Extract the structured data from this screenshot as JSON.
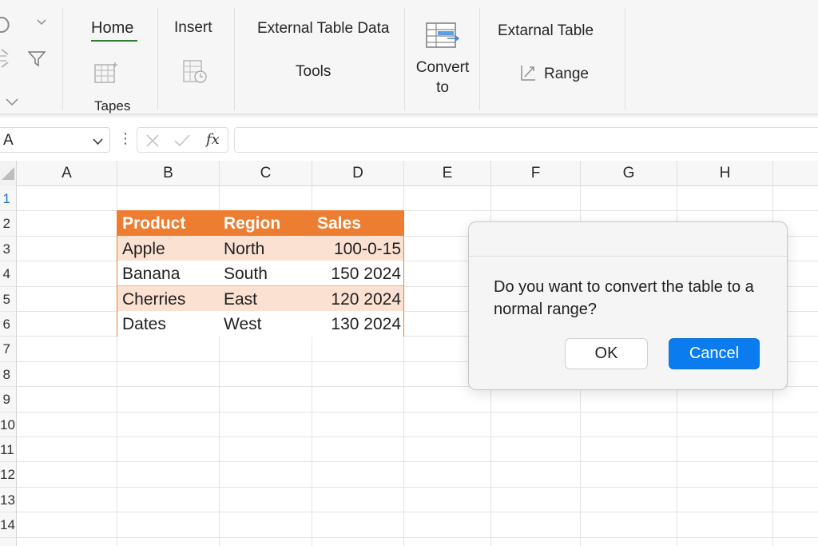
{
  "ribbon": {
    "tabs": {
      "home": "Home",
      "insert": "Insert",
      "external_table_data": "External Table Data",
      "tools": "Tools",
      "convert_to": [
        "Convert",
        "to"
      ],
      "external_table": "Extarnal Table",
      "range": "Range",
      "tapes": "Tapes"
    },
    "active_tab": "Home"
  },
  "formula_bar": {
    "name_box": "A",
    "fx_label": "fx",
    "formula": ""
  },
  "grid": {
    "columns": [
      "A",
      "B",
      "C",
      "D",
      "E",
      "F",
      "G",
      "H"
    ],
    "rows": [
      "1",
      "2",
      "3",
      "4",
      "5",
      "6",
      "7",
      "8",
      "9",
      "10",
      "11",
      "12",
      "13",
      "14"
    ]
  },
  "table": {
    "headers": [
      "Product",
      "Region",
      "Sales"
    ],
    "rows": [
      [
        "Apple",
        "North",
        "100-0-15"
      ],
      [
        "Banana",
        "South",
        "150 2024"
      ],
      [
        "Cherries",
        "East",
        "120 2024"
      ],
      [
        "Dates",
        "West",
        "130 2024"
      ]
    ],
    "header_color": "#ed7d31",
    "band_color": "#fbe1d2"
  },
  "dialog": {
    "message": "Do you want to convert the table to a normal range?",
    "ok_label": "OK",
    "cancel_label": "Cancel",
    "accent": "#0a7cf0"
  }
}
